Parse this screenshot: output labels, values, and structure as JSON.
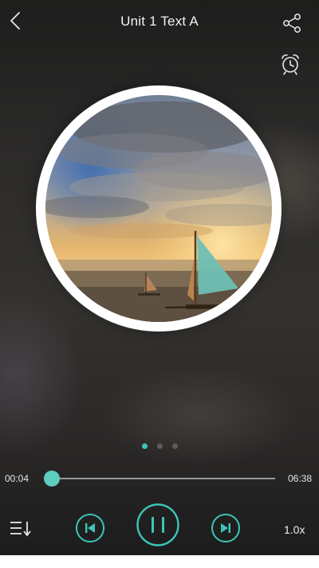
{
  "header": {
    "title": "Unit 1 Text A",
    "icons": {
      "back": "chevron-left-icon",
      "share": "share-icon",
      "alarm": "alarm-clock-icon"
    }
  },
  "cover": {
    "description_icon": "album-cover-sailboats-sunset"
  },
  "pager": {
    "pages": 3,
    "active_index": 0
  },
  "player": {
    "current_time": "00:04",
    "duration": "06:38",
    "progress_fraction": 0.01,
    "speed_label": "1.0x",
    "state": "playing",
    "icons": {
      "playlist": "playlist-icon",
      "previous": "skip-previous-icon",
      "pause": "pause-icon",
      "next": "skip-next-icon"
    }
  },
  "colors": {
    "accent": "#3cc6b7",
    "text": "#f2f2f2",
    "background": "#2b2a29"
  }
}
